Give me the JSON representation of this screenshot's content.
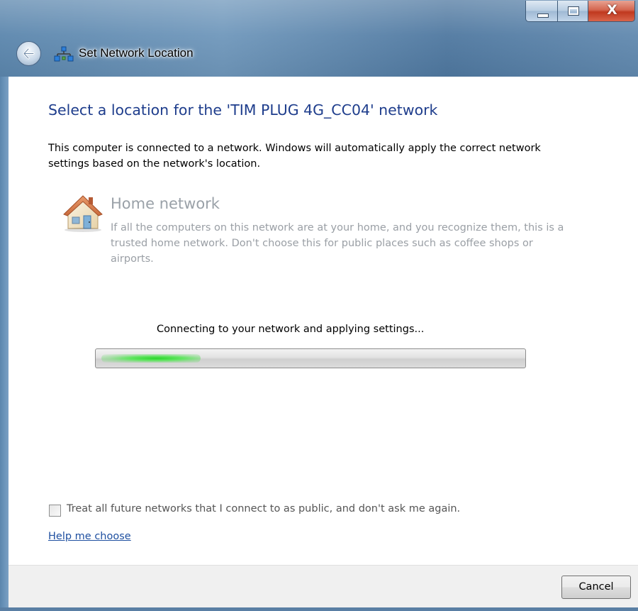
{
  "window": {
    "title": "Set Network Location",
    "caption_buttons": {
      "close_label": "X"
    }
  },
  "main": {
    "heading": "Select a location for the 'TIM PLUG 4G_CC04' network",
    "intro": "This computer is connected to a network. Windows will automatically apply the correct network settings based on the network's location.",
    "location": {
      "title": "Home network",
      "description": "If all the computers on this network are at your home, and you recognize them, this is a trusted home network.  Don't choose this for public places such as coffee shops or airports.",
      "icon": "house-icon"
    },
    "status": "Connecting to your network and applying settings...",
    "progress": {
      "state": "indeterminate",
      "glow_color": "#2bd52b"
    },
    "checkbox": {
      "label": "Treat all future networks that I connect to as public, and don't ask me again.",
      "checked": false
    },
    "help_link": "Help me choose"
  },
  "footer": {
    "cancel_label": "Cancel"
  },
  "colors": {
    "heading": "#1e3d8c",
    "link": "#1e4fa0",
    "disabled_text": "#9aa1a8"
  }
}
